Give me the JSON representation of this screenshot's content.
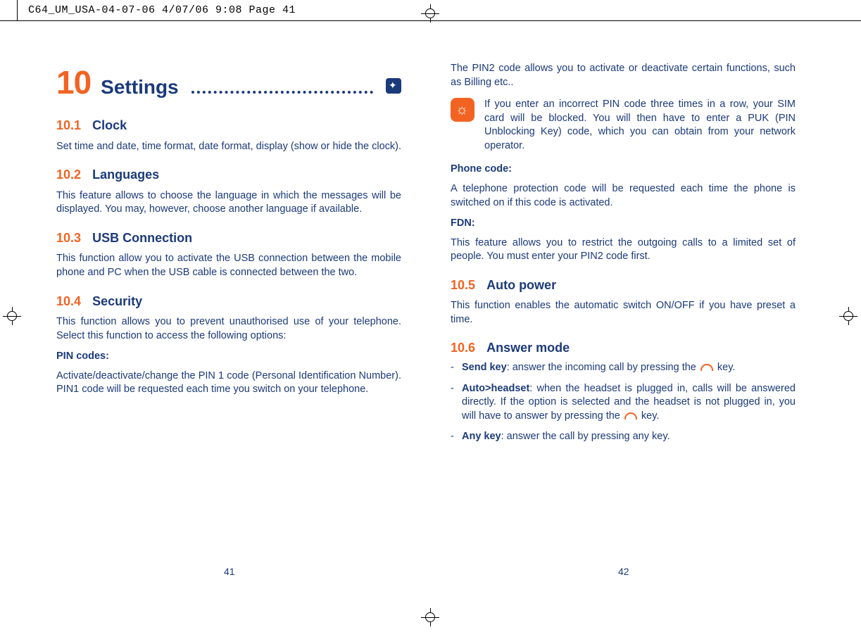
{
  "slug": "C64_UM_USA-04-07-06  4/07/06  9:08  Page 41",
  "chapter": {
    "num": "10",
    "title": "Settings"
  },
  "left": {
    "s1": {
      "num": "10.1",
      "title": "Clock",
      "body": "Set time and date, time format, date format, display (show or hide the clock)."
    },
    "s2": {
      "num": "10.2",
      "title": "Languages",
      "body": "This feature allows to choose the language in which the messages will be displayed. You may, however, choose another language if available."
    },
    "s3": {
      "num": "10.3",
      "title": "USB Connection",
      "body": "This function allow you to activate the USB connection between the mobile phone and PC when the USB cable is connected between the two."
    },
    "s4": {
      "num": "10.4",
      "title": "Security",
      "body": "This function allows you to prevent unauthorised use of your telephone. Select this function to access the following options:",
      "pin_label": "PIN codes:",
      "pin_body": "Activate/deactivate/change the PIN 1 code (Personal Identification Number). PIN1 code will be requested each time you switch on your telephone."
    }
  },
  "right": {
    "pin2_body": "The PIN2 code allows you to activate or deactivate certain functions, such as Billing etc..",
    "note": "If you enter an incorrect PIN code three times in a row, your SIM card will be blocked. You will then have to enter a PUK (PIN Unblocking Key) code, which you can obtain from your network operator.",
    "phone_label": "Phone code:",
    "phone_body": "A telephone protection code will be requested each time the phone is switched on if this code is activated.",
    "fdn_label": "FDN:",
    "fdn_body": "This feature allows you to restrict the outgoing calls to a limited set of people. You must enter your PIN2 code first.",
    "s5": {
      "num": "10.5",
      "title": "Auto power",
      "body": "This function enables the automatic switch ON/OFF if you have preset a time."
    },
    "s6": {
      "num": "10.6",
      "title": "Answer mode",
      "i1a": "Send key",
      "i1b": ": answer the incoming call by pressing the ",
      "i1c": " key.",
      "i2a": "Auto>headset",
      "i2b": ": when the headset is plugged in, calls will be answered directly. If the option is selected and the headset is not plugged in, you will have to answer by pressing the ",
      "i2c": " key.",
      "i3a": "Any key",
      "i3b": ": answer the call by pressing any key."
    }
  },
  "pagenum_left": "41",
  "pagenum_right": "42"
}
